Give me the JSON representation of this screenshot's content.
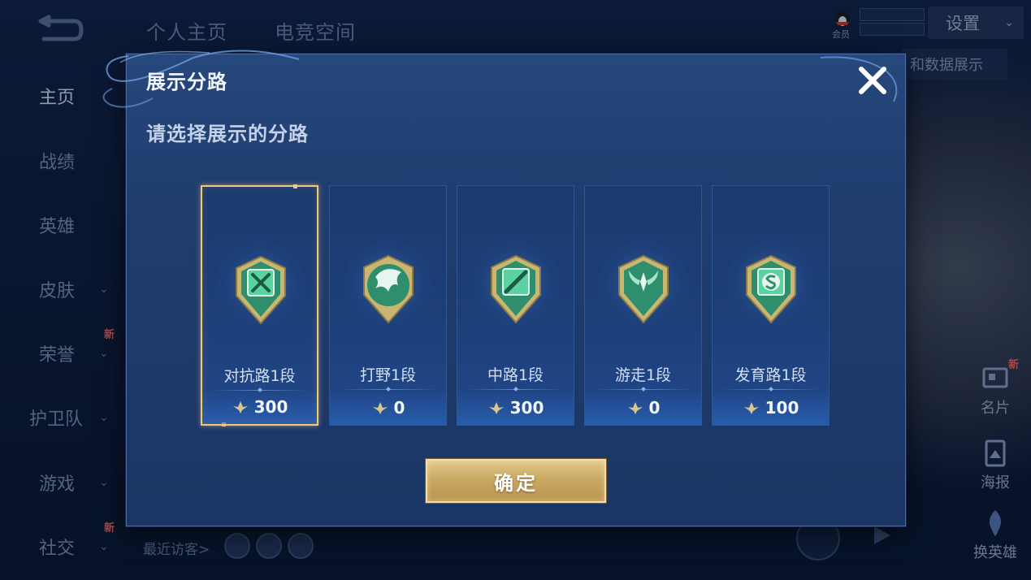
{
  "background": {
    "top_tabs": [
      "个人主页",
      "电竞空间"
    ],
    "sidebar": [
      {
        "label": "主页",
        "active": true,
        "chevron": false,
        "badge": ""
      },
      {
        "label": "战绩",
        "active": false,
        "chevron": false,
        "badge": ""
      },
      {
        "label": "英雄",
        "active": false,
        "chevron": false,
        "badge": ""
      },
      {
        "label": "皮肤",
        "active": false,
        "chevron": true,
        "badge": ""
      },
      {
        "label": "荣誉",
        "active": false,
        "chevron": true,
        "badge": "新"
      },
      {
        "label": "护卫队",
        "active": false,
        "chevron": true,
        "badge": ""
      },
      {
        "label": "游戏",
        "active": false,
        "chevron": true,
        "badge": ""
      },
      {
        "label": "社交",
        "active": false,
        "chevron": true,
        "badge": "新"
      }
    ],
    "settings_label": "设置",
    "data_display_label": "和数据展示",
    "qq_label": "会员",
    "right_buttons": [
      {
        "label": "名片",
        "badge": "新",
        "icon": "card-icon"
      },
      {
        "label": "海报",
        "badge": "",
        "icon": "poster-icon"
      },
      {
        "label": "换英雄",
        "badge": "",
        "icon": "swap-hero-icon"
      }
    ],
    "recent_visitors_label": "最近访客>"
  },
  "modal": {
    "title": "展示分路",
    "subtitle": "请选择展示的分路",
    "close_icon": "close-icon",
    "confirm_label": "确定",
    "selected_index": 0,
    "lanes": [
      {
        "name": "对抗路1段",
        "score": "300",
        "icon": "clash-lane-emblem-icon"
      },
      {
        "name": "打野1段",
        "score": "0",
        "icon": "jungle-emblem-icon"
      },
      {
        "name": "中路1段",
        "score": "300",
        "icon": "mid-lane-emblem-icon"
      },
      {
        "name": "游走1段",
        "score": "0",
        "icon": "roam-emblem-icon"
      },
      {
        "name": "发育路1段",
        "score": "100",
        "icon": "farm-lane-emblem-icon"
      }
    ]
  },
  "colors": {
    "accent_gold": "#f0c877",
    "emblem_green": "#3fbf8a",
    "modal_bg": "#1f3d6f"
  }
}
